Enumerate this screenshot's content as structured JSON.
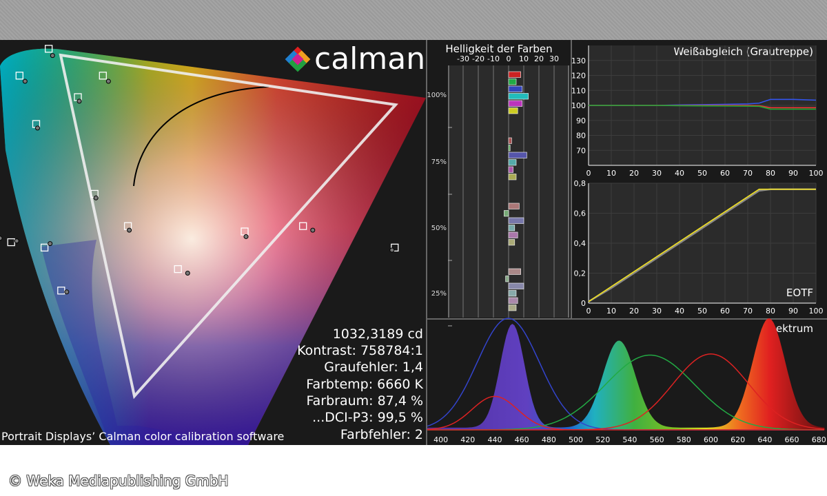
{
  "logo": {
    "text": "calman"
  },
  "caption": "Portrait Displays’ Calman color calibration software",
  "copyright": "© Weka Mediapublishing GmbH",
  "stats": [
    "1032,3189 cd",
    "Kontrast: 758784:1",
    "Graufehler: 1,4",
    "Farbtemp: 6660 K",
    "Farbraum: 87,4 %",
    "...DCI-P3: 99,5 %",
    "Farbfehler: 2"
  ],
  "colors": {
    "red": "#e02020",
    "green": "#20a040",
    "blue": "#2040c0",
    "yellow": "#f0e020"
  },
  "chart_data": [
    {
      "type": "bar",
      "title": "Helligkeit der Farben",
      "x_ticks": [
        "-30",
        "-20",
        "-10",
        "0",
        "10",
        "20",
        "30"
      ],
      "xlim": [
        -40,
        40
      ],
      "y_ticks": [
        "100%",
        "75%",
        "50%",
        "25%"
      ],
      "groups": [
        {
          "level": "100%",
          "bars": [
            {
              "color": "#cc2222",
              "value": 8
            },
            {
              "color": "#22aa44",
              "value": 5
            },
            {
              "color": "#3344bb",
              "value": 9
            },
            {
              "color": "#22bbbb",
              "value": 13
            },
            {
              "color": "#bb33bb",
              "value": 9
            },
            {
              "color": "#cccc22",
              "value": 6
            }
          ]
        },
        {
          "level": "75%",
          "bars": [
            {
              "color": "#aa5555",
              "value": 2
            },
            {
              "color": "#55aa55",
              "value": 1
            },
            {
              "color": "#5555aa",
              "value": 12
            },
            {
              "color": "#55aaaa",
              "value": 5
            },
            {
              "color": "#aa55aa",
              "value": 3
            },
            {
              "color": "#aaaa55",
              "value": 5
            }
          ]
        },
        {
          "level": "50%",
          "bars": [
            {
              "color": "#aa7777",
              "value": 7
            },
            {
              "color": "#77aa77",
              "value": -3
            },
            {
              "color": "#7777aa",
              "value": 10
            },
            {
              "color": "#77aaaa",
              "value": 4
            },
            {
              "color": "#aa77aa",
              "value": 6
            },
            {
              "color": "#aaaa77",
              "value": 4
            }
          ]
        },
        {
          "level": "25%",
          "bars": [
            {
              "color": "#aa8888",
              "value": 8
            },
            {
              "color": "#88aa88",
              "value": -2
            },
            {
              "color": "#8888aa",
              "value": 10
            },
            {
              "color": "#88aaaa",
              "value": 5
            },
            {
              "color": "#aa88aa",
              "value": 6
            },
            {
              "color": "#aaaa88",
              "value": 5
            }
          ]
        }
      ]
    },
    {
      "type": "line",
      "title": "Weißabgleich (Grautreppe)",
      "x": [
        0,
        10,
        20,
        30,
        40,
        50,
        60,
        70,
        75,
        80,
        90,
        100
      ],
      "xlim": [
        0,
        100
      ],
      "ylim": [
        60,
        140
      ],
      "x_ticks": [
        0,
        10,
        20,
        30,
        40,
        50,
        60,
        70,
        80,
        90,
        100
      ],
      "y_ticks": [
        70,
        80,
        90,
        100,
        110,
        120,
        130
      ],
      "series": [
        {
          "color": "#3355ee",
          "values": [
            100,
            100,
            100,
            100,
            100.3,
            100.5,
            100.7,
            101,
            101.5,
            104,
            104,
            103.5
          ]
        },
        {
          "color": "#ee3333",
          "values": [
            100,
            100,
            100,
            100,
            100,
            100,
            100,
            100,
            99.8,
            98.5,
            98.5,
            98.5
          ]
        },
        {
          "color": "#22aa33",
          "values": [
            100,
            100,
            100,
            100,
            99.8,
            99.7,
            99.6,
            99.5,
            99.4,
            97.5,
            97.5,
            97.5
          ]
        }
      ]
    },
    {
      "type": "line",
      "title": "EOTF",
      "x": [
        0,
        10,
        20,
        30,
        40,
        50,
        60,
        70,
        75,
        80,
        90,
        100
      ],
      "xlim": [
        0,
        100
      ],
      "ylim": [
        0,
        0.8
      ],
      "x_ticks": [
        0,
        10,
        20,
        30,
        40,
        50,
        60,
        70,
        80,
        90,
        100
      ],
      "y_ticks": [
        "0",
        "0,2",
        "0,4",
        "0,6",
        "0,8"
      ],
      "y_tick_values": [
        0,
        0.2,
        0.4,
        0.6,
        0.8
      ],
      "series": [
        {
          "color": "#f0e020",
          "values": [
            0.01,
            0.11,
            0.21,
            0.31,
            0.41,
            0.51,
            0.61,
            0.71,
            0.76,
            0.76,
            0.76,
            0.76
          ]
        },
        {
          "color": "#888888",
          "values": [
            0.01,
            0.1,
            0.2,
            0.3,
            0.4,
            0.5,
            0.6,
            0.7,
            0.75,
            0.76,
            0.76,
            0.76
          ]
        }
      ]
    },
    {
      "type": "area",
      "title": "Spektrum",
      "xlim": [
        390,
        685
      ],
      "x_ticks": [
        400,
        420,
        440,
        460,
        480,
        500,
        520,
        540,
        560,
        580,
        600,
        620,
        640,
        660,
        680
      ],
      "peaks": [
        {
          "center": 453,
          "width": 9,
          "height": 0.93
        },
        {
          "center": 532,
          "width": 12,
          "height": 0.78
        },
        {
          "center": 643,
          "width": 12,
          "height": 0.98
        }
      ],
      "sensitivity_curves": [
        {
          "color": "#3344cc",
          "center": 450,
          "width": 23,
          "height": 1.0
        },
        {
          "color": "#22aa44",
          "center": 555,
          "width": 33,
          "height": 0.67
        },
        {
          "color": "#dd2222",
          "center": 600,
          "width": 28,
          "height": 0.68
        },
        {
          "color": "#dd2222",
          "center": 440,
          "width": 17,
          "height": 0.3
        }
      ]
    },
    {
      "type": "scatter",
      "title": "",
      "gamut_triangle": [
        [
          0.68,
          0.32
        ],
        [
          0.265,
          0.69
        ],
        [
          0.15,
          0.06
        ]
      ],
      "white_point": [
        0.313,
        0.329
      ],
      "targets": [
        [
          0.68,
          0.32
        ],
        [
          0.265,
          0.69
        ],
        [
          0.15,
          0.06
        ],
        [
          0.32,
          0.42
        ],
        [
          0.36,
          0.36
        ],
        [
          0.22,
          0.33
        ],
        [
          0.5,
          0.35
        ],
        [
          0.3,
          0.6
        ],
        [
          0.25,
          0.55
        ],
        [
          0.42,
          0.28
        ],
        [
          0.28,
          0.24
        ],
        [
          0.19,
          0.15
        ],
        [
          0.57,
          0.36
        ],
        [
          0.23,
          0.64
        ],
        [
          0.33,
          0.64
        ],
        [
          0.18,
          0.33
        ],
        [
          0.2,
          0.34
        ],
        [
          0.26,
          0.32
        ]
      ],
      "measured": [
        [
          0.675,
          0.318
        ],
        [
          0.268,
          0.68
        ],
        [
          0.152,
          0.065
        ],
        [
          0.32,
          0.415
        ],
        [
          0.36,
          0.355
        ],
        [
          0.225,
          0.335
        ],
        [
          0.5,
          0.343
        ],
        [
          0.3,
          0.595
        ],
        [
          0.25,
          0.545
        ],
        [
          0.43,
          0.275
        ],
        [
          0.285,
          0.24
        ],
        [
          0.192,
          0.155
        ],
        [
          0.58,
          0.355
        ],
        [
          0.235,
          0.632
        ],
        [
          0.335,
          0.632
        ],
        [
          0.185,
          0.335
        ],
        [
          0.205,
          0.34
        ],
        [
          0.265,
          0.33
        ]
      ]
    }
  ]
}
